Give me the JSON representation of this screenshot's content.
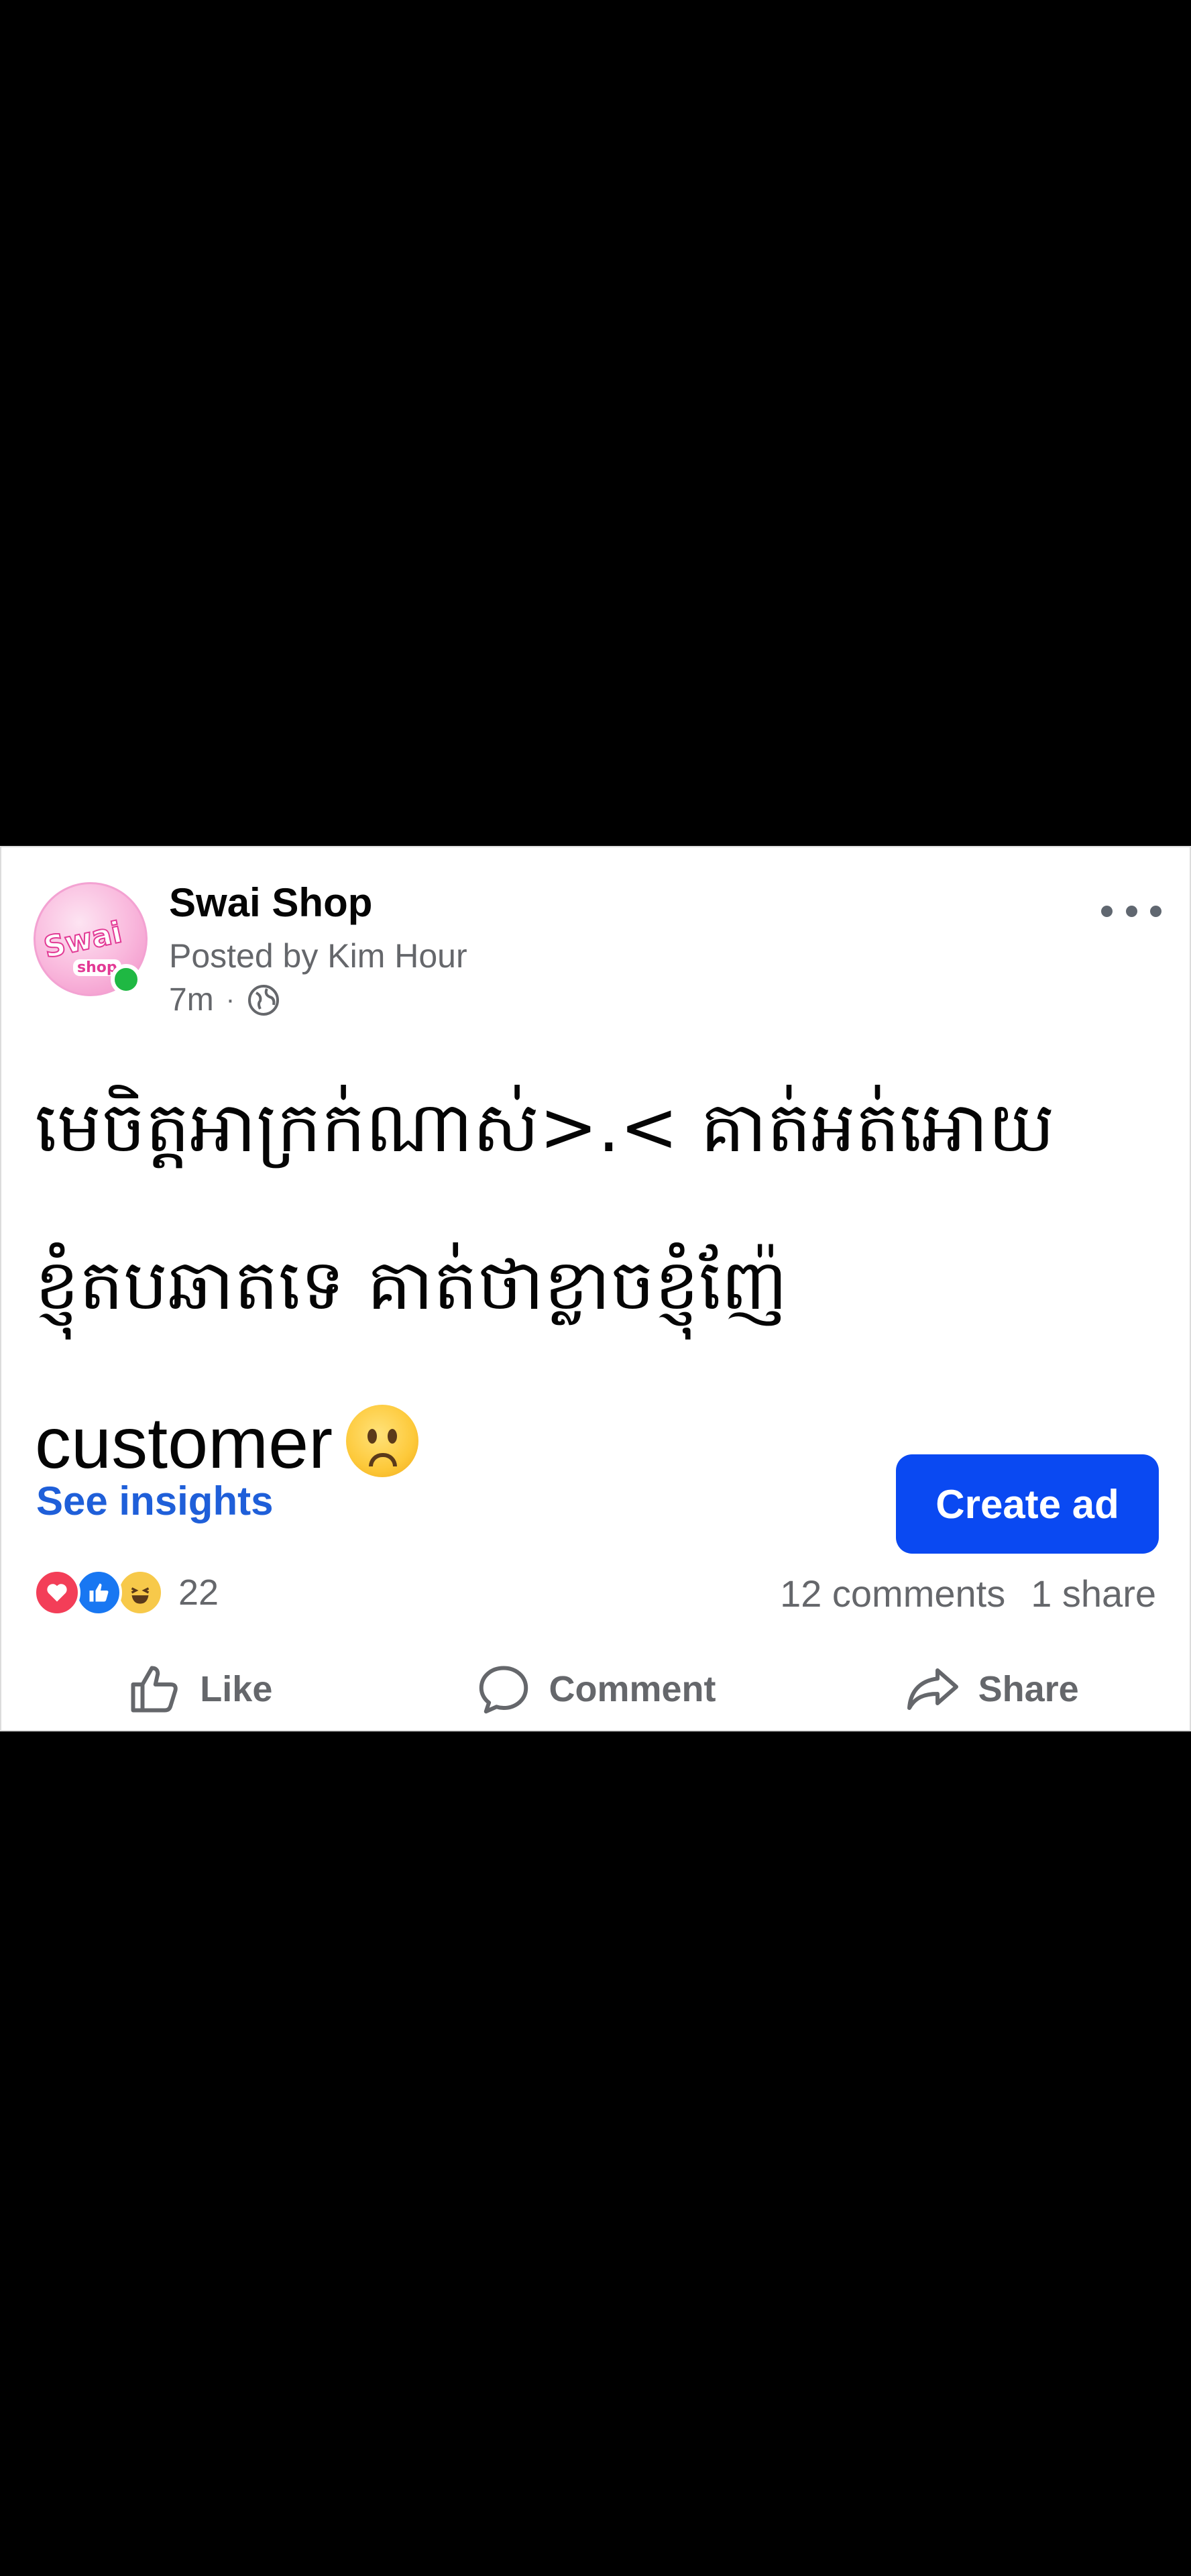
{
  "post": {
    "page_name": "Swai Shop",
    "posted_by": "Posted by Kim Hour",
    "time": "7m",
    "separator": "·",
    "privacy_icon": "globe-icon",
    "more_icon": "more-options-icon",
    "text_line_1": "មេចិត្តអាក្រក់ណាស់>.< គាត់អត់អោយ",
    "text_line_2": "ខ្ញុំតបឆាតទេ គាត់ថាខ្លាចខ្ញុំញ៉ែ",
    "text_line_3": "customer",
    "emoji": "frowning-face-emoji"
  },
  "avatar": {
    "logo_text": "Swai",
    "logo_sub": "shop",
    "status": "online",
    "online_color": "#1fb843"
  },
  "insights": {
    "see_insights_label": "See insights",
    "create_ad_label": "Create ad"
  },
  "stats": {
    "reaction_icons": [
      "love-icon",
      "like-icon",
      "haha-icon"
    ],
    "reaction_count": "22",
    "comments": "12 comments",
    "shares": "1 share"
  },
  "actions": {
    "like_label": "Like",
    "comment_label": "Comment",
    "share_label": "Share"
  },
  "colors": {
    "link_blue": "#1f5fd9",
    "button_blue": "#0a49f2",
    "muted_text": "#65676b"
  }
}
